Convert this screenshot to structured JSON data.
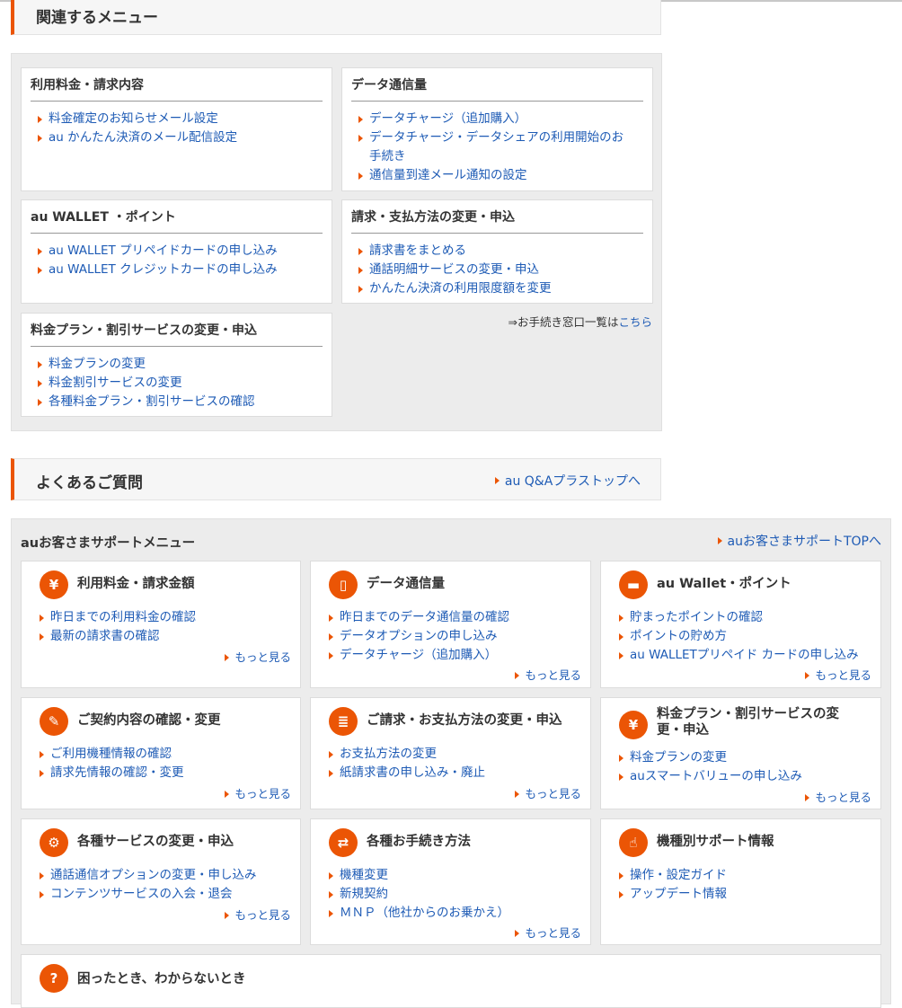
{
  "related": {
    "title": "関連するメニュー",
    "cards": [
      {
        "title": "利用料金・請求内容",
        "items": [
          "料金確定のお知らせメール設定",
          "au かんたん決済のメール配信設定"
        ]
      },
      {
        "title": "データ通信量",
        "items": [
          "データチャージ（追加購入）",
          "データチャージ・データシェアの利用開始のお",
          "手続き",
          "通信量到達メール通知の設定"
        ]
      },
      {
        "title": "au WALLET ・ポイント",
        "items": [
          "au WALLET プリペイドカードの申し込み",
          "au WALLET クレジットカードの申し込み"
        ]
      },
      {
        "title": "請求・支払方法の変更・申込",
        "items": [
          "請求書をまとめる",
          "通話明細サービスの変更・申込",
          "かんたん決済の利用限度額を変更"
        ]
      },
      {
        "title": "料金プラン・割引サービスの変更・申込",
        "items": [
          "料金プランの変更",
          "料金割引サービスの変更",
          "各種料金プラン・割引サービスの確認"
        ]
      }
    ],
    "window_note_prefix": "⇒お手続き窓口一覧は",
    "window_note_link": "こちら"
  },
  "faq": {
    "title": "よくあるご質問",
    "link": "au Q&Aプラストップへ"
  },
  "support": {
    "title": "auお客さまサポートメニュー",
    "top_link": "auお客さまサポートTOPへ",
    "more_label": "もっと見る",
    "cards": [
      {
        "icon": "yen-icon",
        "glyph": "¥",
        "title": "利用料金・請求金額",
        "items": [
          "昨日までの利用料金の確認",
          "最新の請求書の確認"
        ]
      },
      {
        "icon": "smartphone-icon",
        "glyph": "▯",
        "title": "データ通信量",
        "items": [
          "昨日までのデータ通信量の確認",
          "データオプションの申し込み",
          "データチャージ（追加購入）"
        ]
      },
      {
        "icon": "wallet-card-icon",
        "glyph": "▬",
        "title": "au Wallet・ポイント",
        "items": [
          "貯まったポイントの確認",
          "ポイントの貯め方",
          "au WALLETプリペイド カードの申し込み"
        ]
      },
      {
        "icon": "pen-icon",
        "glyph": "✎",
        "title": "ご契約内容の確認・変更",
        "items": [
          "ご利用機種情報の確認",
          "請求先情報の確認・変更"
        ]
      },
      {
        "icon": "document-icon",
        "glyph": "≣",
        "title": "ご請求・お支払方法の変更・申込",
        "items": [
          "お支払方法の変更",
          "紙請求書の申し込み・廃止"
        ]
      },
      {
        "icon": "yen-icon",
        "glyph": "¥",
        "title": "料金プラン・割引サービスの変更・申込",
        "items": [
          "料金プランの変更",
          "auスマートバリューの申し込み"
        ]
      },
      {
        "icon": "gears-icon",
        "glyph": "⚙",
        "title": "各種サービスの変更・申込",
        "items": [
          "通話通信オプションの変更・申し込み",
          "コンテンツサービスの入会・退会"
        ]
      },
      {
        "icon": "phone-new-icon",
        "glyph": "⇄",
        "title": "各種お手続き方法",
        "items": [
          "機種変更",
          "新規契約",
          "ＭＮＰ（他社からのお乗かえ）"
        ]
      },
      {
        "icon": "phone-touch-icon",
        "glyph": "☝",
        "title": "機種別サポート情報",
        "items": [
          "操作・設定ガイド",
          "アップデート情報"
        ]
      },
      {
        "icon": "question-person-icon",
        "glyph": "?",
        "title": "困ったとき、わからないとき",
        "items": []
      }
    ]
  }
}
